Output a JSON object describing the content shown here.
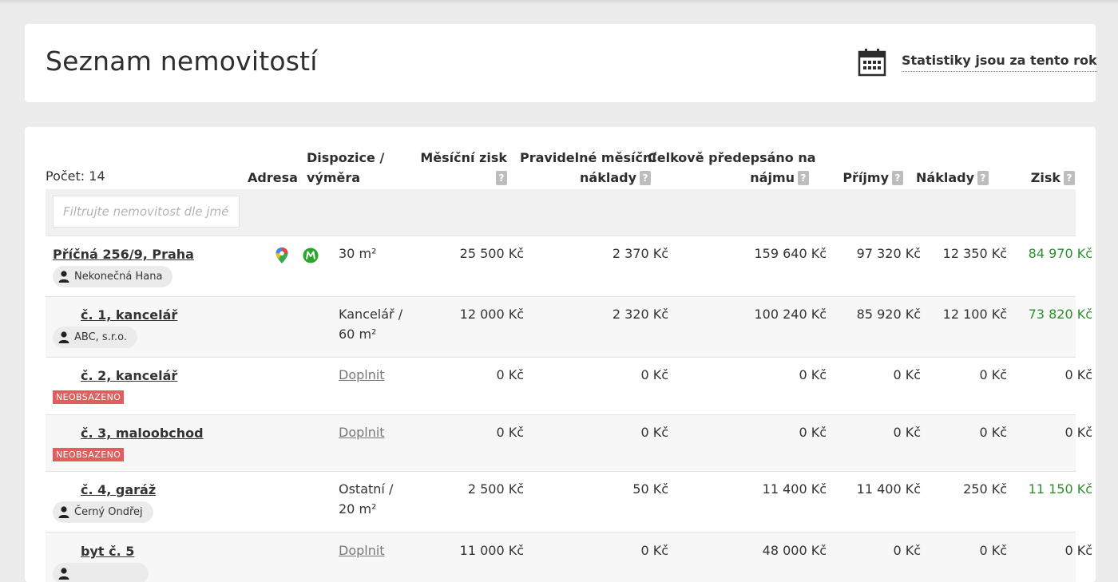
{
  "header": {
    "title": "Seznam nemovitostí",
    "stats_label": "Statistiky jsou za tento rok",
    "stats_icon": "calendar-icon"
  },
  "table": {
    "count_label": "Počet: 14",
    "columns": {
      "address": "Adresa",
      "disposition_line1": "Dispozice /",
      "disposition_line2": "výměra",
      "monthly_profit_line1": "Měsíční zisk",
      "monthly_costs_line1": "Pravidelné měsíční",
      "monthly_costs_line2": "náklady",
      "prescribed_line1": "Celkově předepsáno na",
      "prescribed_line2": "nájmu",
      "income": "Příjmy",
      "costs": "Náklady",
      "profit": "Zisk",
      "help_glyph": "?"
    },
    "filter_placeholder": "Filtrujte nemovitost dle jména",
    "vacant_label": "NEOBSAZENO",
    "fill_label": "Doplnit",
    "rows": [
      {
        "name": "Příčná 256/9, Praha",
        "tenant": "Nekonečná Hana",
        "disposition_line1": "30 m²",
        "disposition_line2": "",
        "monthly_profit": "25 500 Kč",
        "monthly_costs": "2 370 Kč",
        "prescribed": "159 640 Kč",
        "income": "97 320 Kč",
        "costs": "12 350 Kč",
        "profit": "84 970 Kč"
      },
      {
        "name": "č. 1, kancelář",
        "tenant": "ABC, s.r.o.",
        "disposition_line1": "Kancelář /",
        "disposition_line2": "60 m²",
        "monthly_profit": "12 000 Kč",
        "monthly_costs": "2 320 Kč",
        "prescribed": "100 240 Kč",
        "income": "85 920 Kč",
        "costs": "12 100 Kč",
        "profit": "73 820 Kč"
      },
      {
        "name": "č. 2, kancelář",
        "monthly_profit": "0 Kč",
        "monthly_costs": "0 Kč",
        "prescribed": "0 Kč",
        "income": "0 Kč",
        "costs": "0 Kč",
        "profit": "0 Kč"
      },
      {
        "name": "č. 3, maloobchod",
        "monthly_profit": "0 Kč",
        "monthly_costs": "0 Kč",
        "prescribed": "0 Kč",
        "income": "0 Kč",
        "costs": "0 Kč",
        "profit": "0 Kč"
      },
      {
        "name": "č. 4, garáž",
        "tenant": "Černý Ondřej",
        "disposition_line1": "Ostatní /",
        "disposition_line2": "20 m²",
        "monthly_profit": "2 500 Kč",
        "monthly_costs": "50 Kč",
        "prescribed": "11 400 Kč",
        "income": "11 400 Kč",
        "costs": "250 Kč",
        "profit": "11 150 Kč"
      },
      {
        "name": "byt č. 5",
        "monthly_profit": "11 000 Kč",
        "monthly_costs": "0 Kč",
        "prescribed": "48 000 Kč",
        "income": "0 Kč",
        "costs": "0 Kč",
        "profit": "0 Kč"
      }
    ]
  },
  "colors": {
    "background": "#ececec",
    "card": "#ffffff",
    "profit_positive": "#2f8f2f",
    "vacant_badge": "#e15e5e",
    "row_alt": "#f7f7f7"
  }
}
